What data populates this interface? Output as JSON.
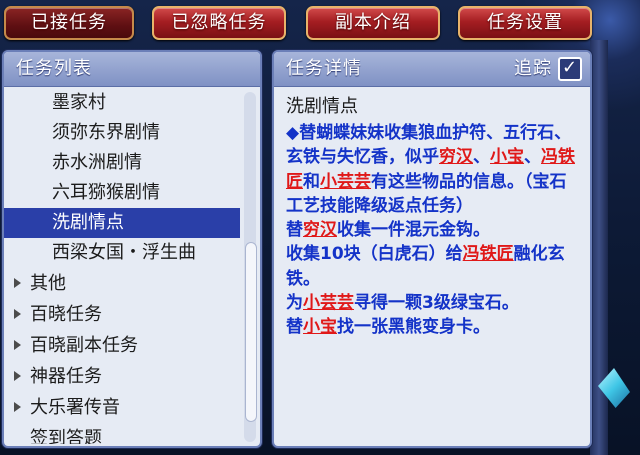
{
  "tabs": [
    {
      "label": "已接任务",
      "active": true
    },
    {
      "label": "已忽略任务"
    },
    {
      "label": "副本介绍"
    },
    {
      "label": "任务设置"
    }
  ],
  "left_panel": {
    "title": "任务列表",
    "quest_items": [
      "墨家村",
      "须弥东界剧情",
      "赤水洲剧情",
      "六耳猕猴剧情",
      "洗剧情点",
      "西梁女国・浮生曲"
    ],
    "selected_index": 4,
    "categories": [
      "其他",
      "百晓任务",
      "百晓副本任务",
      "神器任务",
      "大乐署传音",
      "签到答题"
    ]
  },
  "right_panel": {
    "title": "任务详情",
    "track_label": "追踪",
    "track_checked": true,
    "checkbox_glyph": "✓",
    "quest_name": "洗剧情点",
    "desc": {
      "p1": "◆替蝴蝶妹妹收集狼血护符、五行石、玄铁与失忆香，似乎",
      "npc1": "穷汉",
      "sep1": "、",
      "npc2": "小宝",
      "sep2": "、",
      "npc3": "冯铁匠",
      "sep3": "和",
      "npc4": "小芸芸",
      "p2": "有这些物品的信息。（宝石工艺技能降级返点任务）",
      "l2_pre": "替",
      "l2_npc": "穷汉",
      "l2_post": "收集一件混元金钩。",
      "l3_pre": "收集10块（白虎石）给",
      "l3_npc": "冯铁匠",
      "l3_post": "融化玄铁。",
      "l4_pre": "为",
      "l4_npc": "小芸芸",
      "l4_post": "寻得一颗3级绿宝石。",
      "l5_pre": "替",
      "l5_npc": "小宝",
      "l5_post": "找一张黑熊变身卡。"
    }
  }
}
